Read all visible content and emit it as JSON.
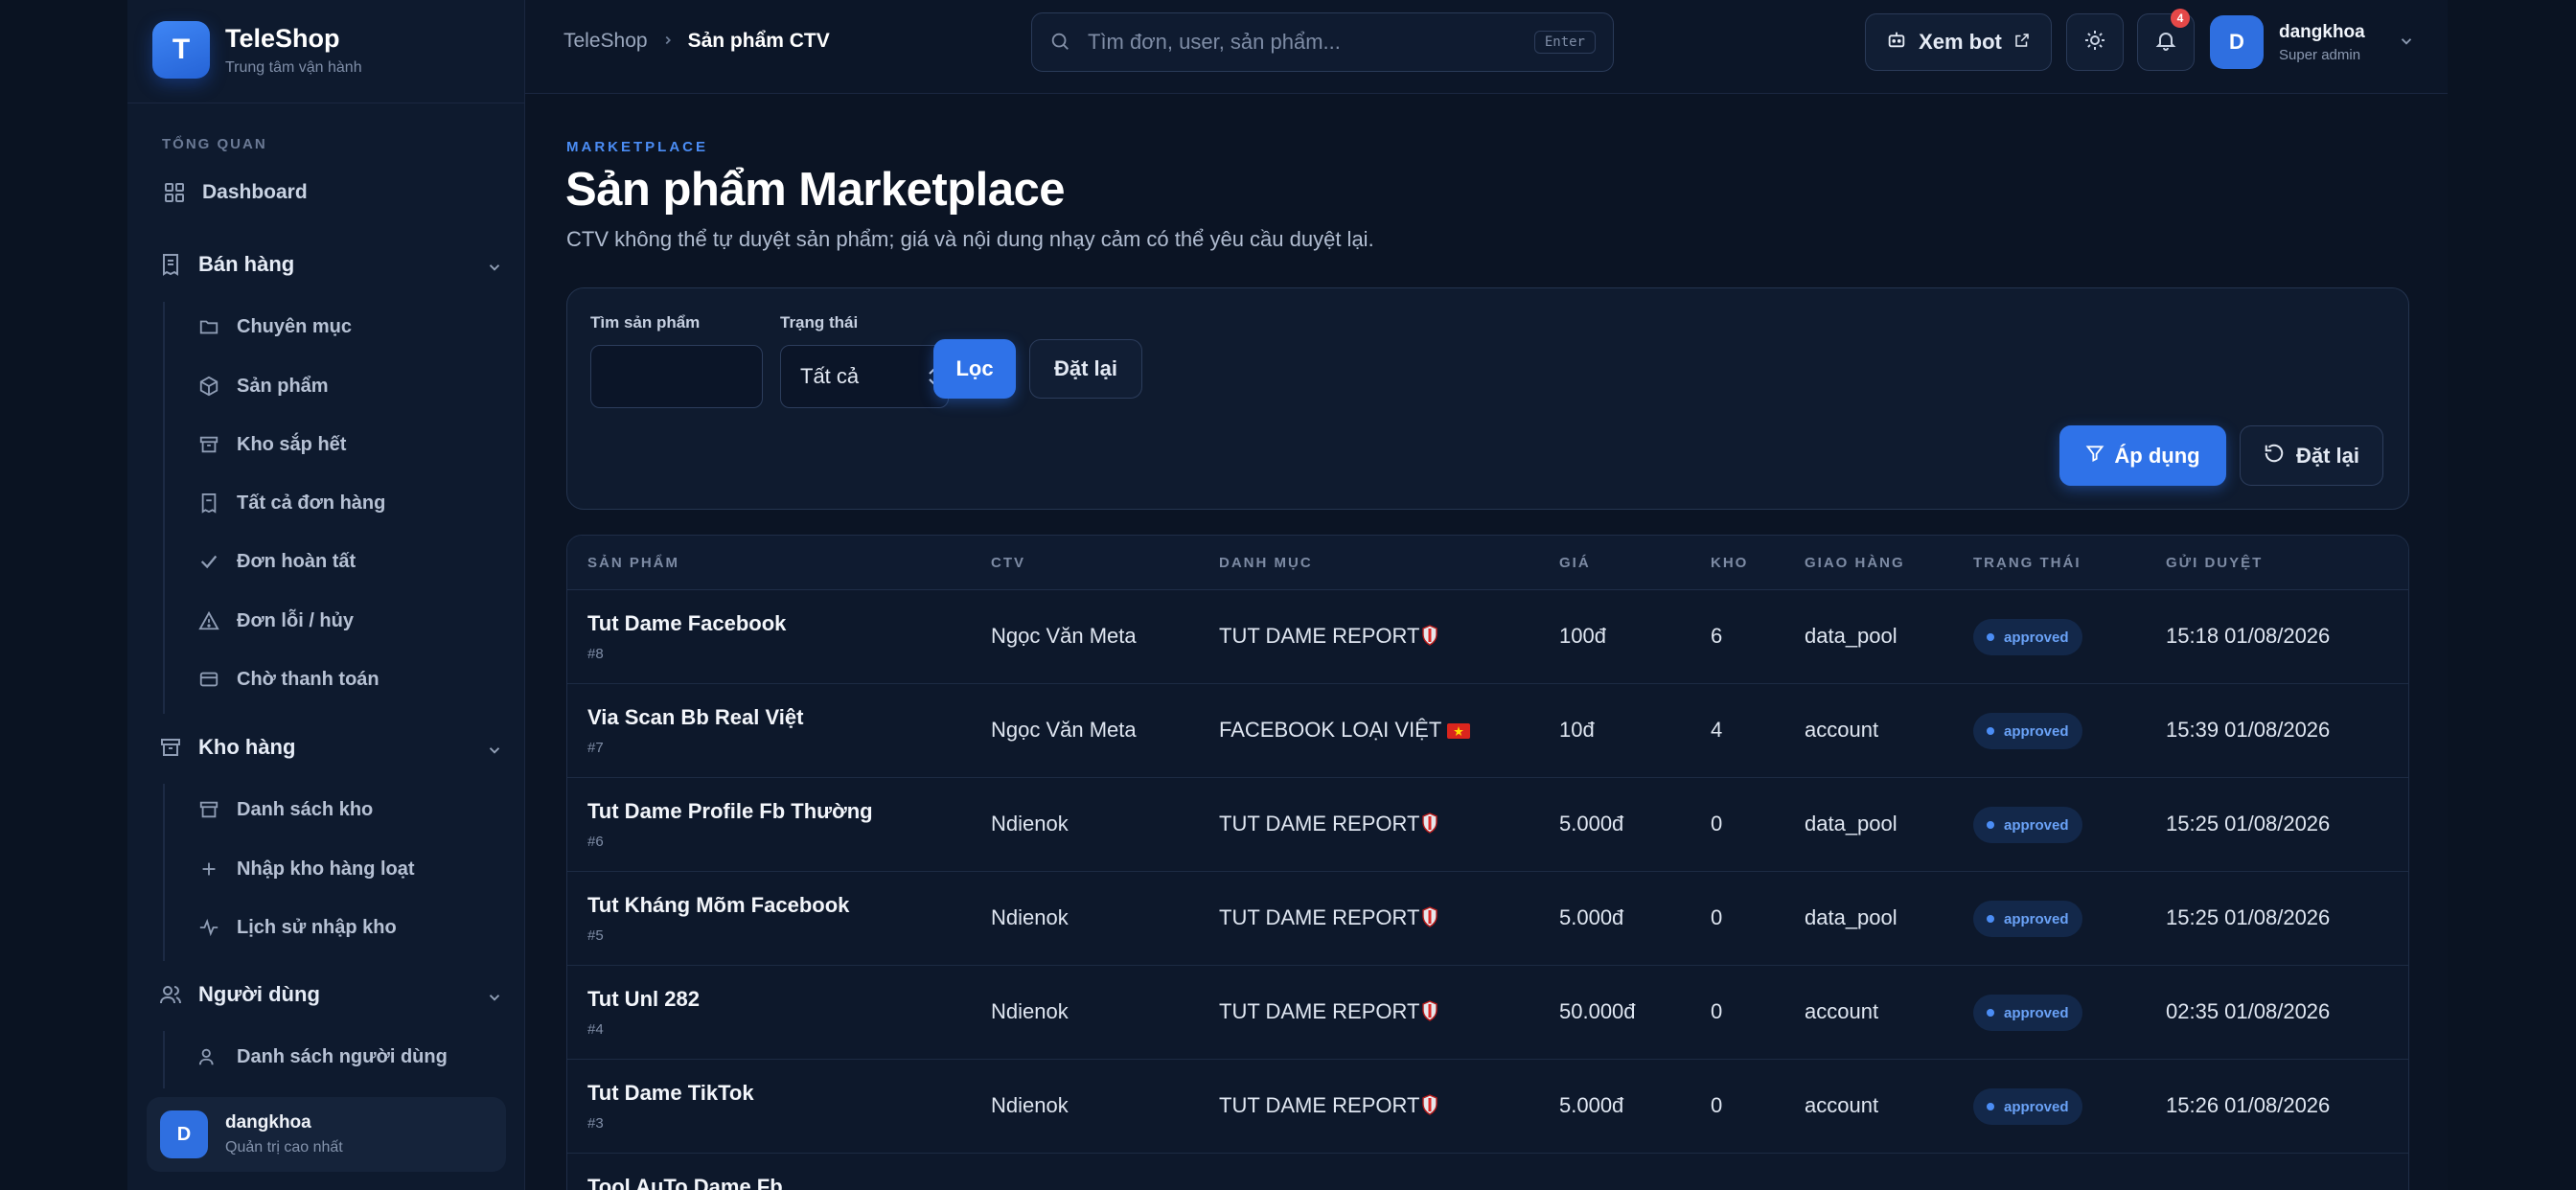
{
  "brand": {
    "logo_letter": "T",
    "name": "TeleShop",
    "subtitle": "Trung tâm vận hành"
  },
  "sidebar": {
    "section_title": "TỔNG QUAN",
    "dashboard": "Dashboard",
    "groups": {
      "sales": {
        "label": "Bán hàng",
        "items": [
          "Chuyên mục",
          "Sản phẩm",
          "Kho sắp hết",
          "Tất cả đơn hàng",
          "Đơn hoàn tất",
          "Đơn lỗi / hủy",
          "Chờ thanh toán"
        ]
      },
      "warehouse": {
        "label": "Kho hàng",
        "items": [
          "Danh sách kho",
          "Nhập kho hàng loạt",
          "Lịch sử nhập kho"
        ]
      },
      "users": {
        "label": "Người dùng",
        "items": [
          "Danh sách người dùng"
        ]
      }
    },
    "user_card": {
      "avatar_letter": "D",
      "name": "dangkhoa",
      "role": "Quản trị cao nhất"
    }
  },
  "topbar": {
    "breadcrumb": [
      "TeleShop",
      "Sản phẩm CTV"
    ],
    "search_placeholder": "Tìm đơn, user, sản phẩm...",
    "search_kbd": "Enter",
    "view_bot": "Xem bot",
    "notifications_count": "4",
    "profile": {
      "avatar_letter": "D",
      "name": "dangkhoa",
      "role": "Super admin"
    }
  },
  "page": {
    "eyebrow": "MARKETPLACE",
    "title": "Sản phẩm Marketplace",
    "subtitle": "CTV không thể tự duyệt sản phẩm; giá và nội dung nhạy cảm có thể yêu cầu duyệt lại."
  },
  "filters": {
    "search_label": "Tìm sản phẩm",
    "search_value": "",
    "status_label": "Trạng thái",
    "status_value": "Tất cả",
    "filter_btn": "Lọc",
    "reset_btn": "Đặt lại",
    "apply_btn": "Áp dụng",
    "reset_btn2": "Đặt lại"
  },
  "table": {
    "headers": [
      "SẢN PHẨM",
      "CTV",
      "DANH MỤC",
      "GIÁ",
      "KHO",
      "GIAO HÀNG",
      "TRẠNG THÁI",
      "GỬI DUYỆT"
    ],
    "rows": [
      {
        "name": "Tut Dame Facebook",
        "id": "#8",
        "ctv": "Ngọc Văn Meta",
        "category": "TUT DAME REPORT",
        "cat_icon": "shield-icon",
        "price": "100đ",
        "stock": "6",
        "delivery": "data_pool",
        "status": "approved",
        "submitted": "15:18 01/08/2026"
      },
      {
        "name": "Via Scan Bb Real Việt",
        "id": "#7",
        "ctv": "Ngọc Văn Meta",
        "category": "FACEBOOK LOẠI VIỆT",
        "cat_icon": "vn-flag-icon",
        "price": "10đ",
        "stock": "4",
        "delivery": "account",
        "status": "approved",
        "submitted": "15:39 01/08/2026"
      },
      {
        "name": "Tut Dame Profile Fb Thường",
        "id": "#6",
        "ctv": "Ndienok",
        "category": "TUT DAME REPORT",
        "cat_icon": "shield-icon",
        "price": "5.000đ",
        "stock": "0",
        "delivery": "data_pool",
        "status": "approved",
        "submitted": "15:25 01/08/2026"
      },
      {
        "name": "Tut Kháng Mõm Facebook",
        "id": "#5",
        "ctv": "Ndienok",
        "category": "TUT DAME REPORT",
        "cat_icon": "shield-icon",
        "price": "5.000đ",
        "stock": "0",
        "delivery": "data_pool",
        "status": "approved",
        "submitted": "15:25 01/08/2026"
      },
      {
        "name": "Tut Unl 282",
        "id": "#4",
        "ctv": "Ndienok",
        "category": "TUT DAME REPORT",
        "cat_icon": "shield-icon",
        "price": "50.000đ",
        "stock": "0",
        "delivery": "account",
        "status": "approved",
        "submitted": "02:35 01/08/2026"
      },
      {
        "name": "Tut Dame TikTok",
        "id": "#3",
        "ctv": "Ndienok",
        "category": "TUT DAME REPORT",
        "cat_icon": "shield-icon",
        "price": "5.000đ",
        "stock": "0",
        "delivery": "account",
        "status": "approved",
        "submitted": "15:26 01/08/2026"
      },
      {
        "name": "Tool AuTo Dame Fb",
        "id": "",
        "ctv": "",
        "category": "",
        "cat_icon": "",
        "price": "",
        "stock": "",
        "delivery": "",
        "status": "",
        "submitted": ""
      }
    ]
  },
  "colors": {
    "accent": "#2f72e8",
    "background": "#0b1424",
    "sidebar": "#0e1a2e",
    "status_text": "#6aa2f7"
  }
}
